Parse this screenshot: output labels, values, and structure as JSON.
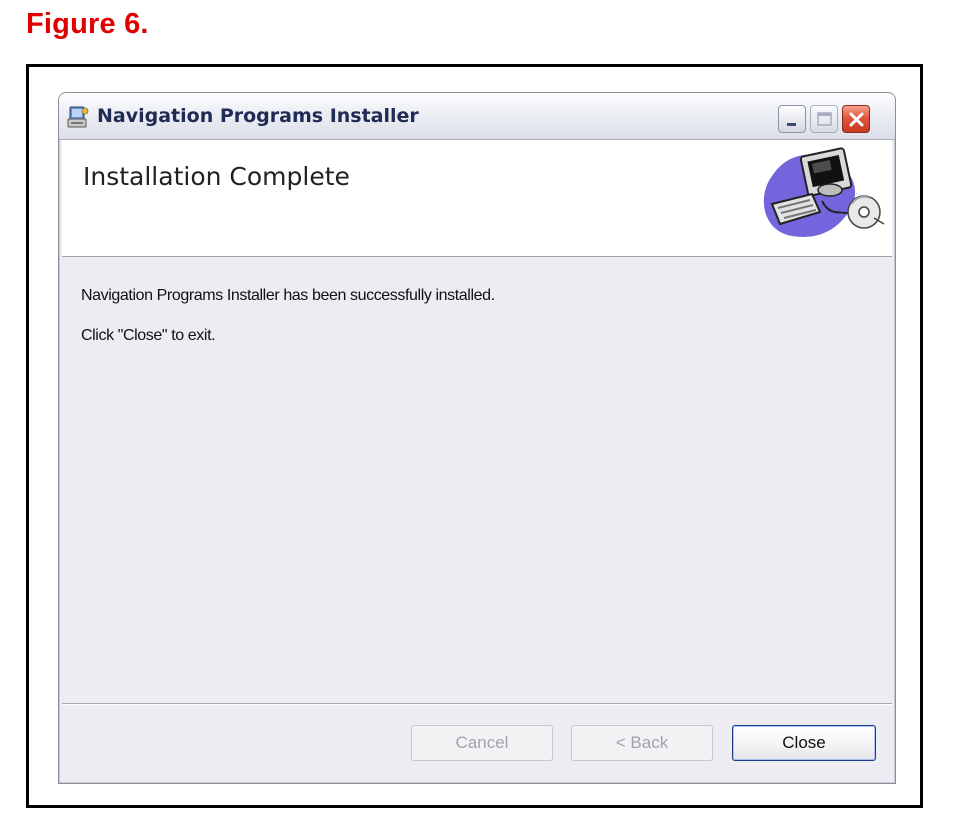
{
  "figure": {
    "title": "Figure 6."
  },
  "window": {
    "title": "Navigation Programs Installer",
    "icons": [
      "installer-icon",
      "minimize-icon",
      "maximize-icon",
      "close-icon"
    ]
  },
  "header": {
    "title": "Installation Complete",
    "image": "computer-cd-icon"
  },
  "content": {
    "message": "Navigation Programs Installer has been successfully installed.",
    "instruction": "Click \"Close\" to exit."
  },
  "buttons": {
    "cancel": {
      "label": "Cancel",
      "enabled": false
    },
    "back": {
      "label": "< Back",
      "enabled": false
    },
    "close": {
      "label": "Close",
      "enabled": true
    }
  },
  "colors": {
    "figure_title": "#e10000",
    "dialog_bg": "#ececf2",
    "close_button_border": "#1c3c8c"
  }
}
